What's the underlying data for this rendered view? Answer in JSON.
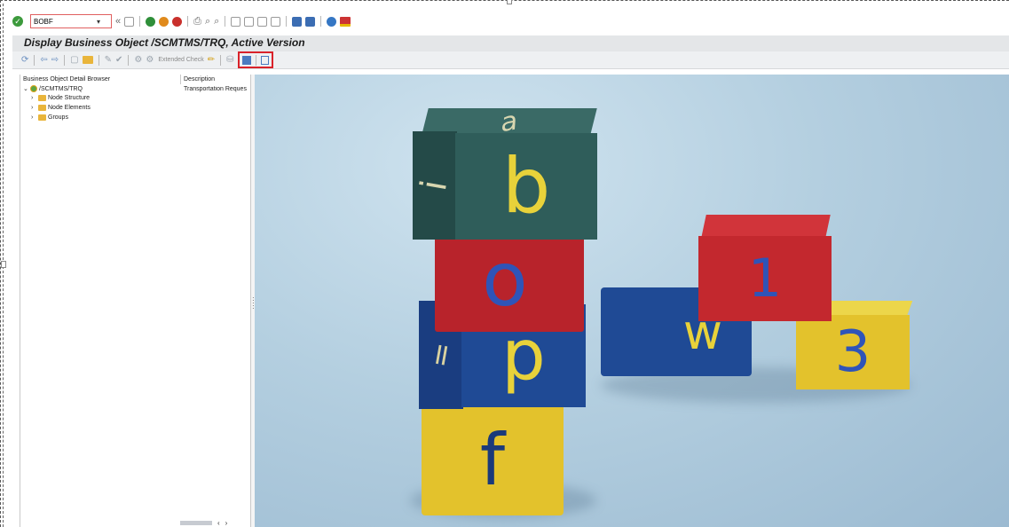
{
  "system_toolbar": {
    "command_value": "BOBF",
    "back_symbol": "«"
  },
  "title": "Display Business Object /SCMTMS/TRQ, Active Version",
  "app_toolbar": {
    "extended_check_label": "Extended Check"
  },
  "tree": {
    "columns": [
      "Business Object Detail Browser",
      "Description"
    ],
    "root": {
      "label": "/SCMTMS/TRQ",
      "description": "Transportation Reques"
    },
    "items": [
      {
        "label": "Node Structure"
      },
      {
        "label": "Node Elements"
      },
      {
        "label": "Groups"
      }
    ]
  },
  "photo": {
    "blocks": [
      {
        "letter": "a",
        "color": "#2f5d5a"
      },
      {
        "letter": "b",
        "color": "#2f5d5a",
        "side_letter": "i"
      },
      {
        "letter": "o",
        "color": "#b8232b"
      },
      {
        "letter": "p",
        "color": "#1f4a95",
        "side_letter": "="
      },
      {
        "letter": "f",
        "color": "#e3c22c"
      },
      {
        "letter": "1",
        "color": "#c3282e"
      },
      {
        "letter": "w",
        "color": "#1f4a95"
      },
      {
        "letter": "3",
        "color": "#e3c22c"
      }
    ],
    "letter_colors": {
      "yellow": "#e8d23a",
      "blue": "#2f54b8",
      "dark": "#1b3a7a"
    }
  }
}
